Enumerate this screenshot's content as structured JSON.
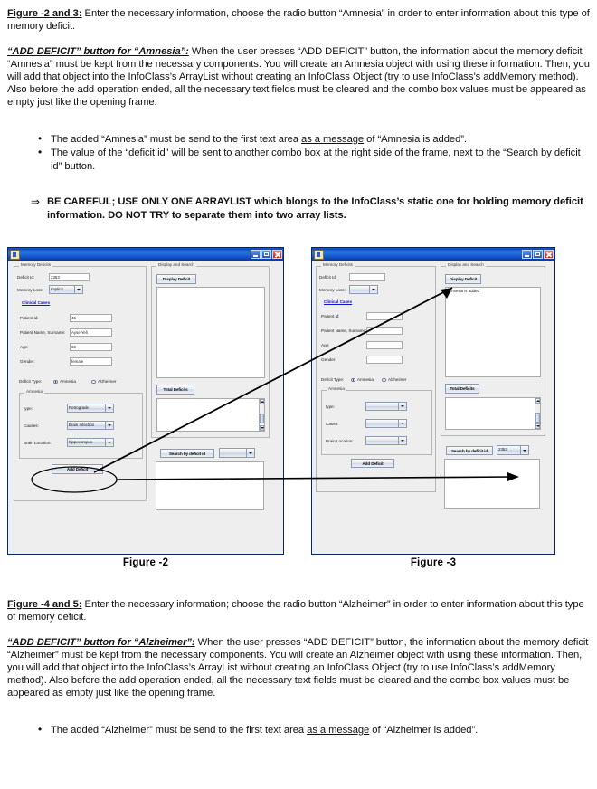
{
  "document": {
    "para1": {
      "lead": "Figure -2 and 3:",
      "body": " Enter the necessary information, choose the radio button “Amnesia” in order to enter information about this type of memory deficit."
    },
    "para2": {
      "lead": "“ADD DEFICIT” button for “Amnesia”:",
      "body": " When the user presses “ADD DEFICIT” button, the information about the memory deficit “Amnesia” must be kept from the necessary components. You will create an Amnesia object with using these information. Then, you will add that object into the InfoClass’s ArrayList without creating an InfoClass Object (try to use InfoClass’s addMemory method). Also before the add operation ended, all the necessary text fields must be cleared and the combo box values must be appeared as empty just like the opening frame."
    },
    "bullets1": [
      {
        "pre": "The added “Amnesia” must be send to the first text area ",
        "underline": "as a message",
        "post": " of “Amnesia is added”."
      },
      {
        "pre": "The value of the “deficit id” will be sent to another combo box at the right side of the frame, next to the “Search by deficit id” button.",
        "underline": "",
        "post": ""
      }
    ],
    "callout": "BE CAREFUL; USE ONLY ONE ARRAYLIST which blongs to the InfoClass’s static one for holding memory deficit information. DO NOT TRY to separate them into two array lists.",
    "para3": {
      "lead": "Figure -4 and 5:",
      "body": " Enter the necessary information; choose the radio button “Alzheimer” in order to enter information about this type of memory deficit."
    },
    "para4": {
      "lead": "“ADD DEFICIT” button for “Alzheimer”:",
      "body": " When the user presses “ADD DEFICIT” button, the information about the memory deficit “Alzheimer” must be kept from the necessary components. You will create an Alzheimer object with using these information. Then, you will add that object into the InfoClass’s ArrayList without creating an InfoClass Object (try to use InfoClass’s addMemory method). Also before the add operation ended, all the necessary text fields must be cleared and the combo box values must be appeared as empty just like the opening frame."
    },
    "bullets2": [
      {
        "pre": "The added “Alzheimer” must be send to the first text area ",
        "underline": "as a message",
        "post": " of “Alzheimer is added”."
      }
    ]
  },
  "figure2": {
    "caption": "Figure -2",
    "window_title": "",
    "left_group_title": "Memory Deficits",
    "labels": {
      "deficit_id": "Deficit Id:",
      "memory_loss": "Memory Loss:",
      "clinical_cases": "Clinical Cases",
      "patient_id": "Patient id:",
      "patient_name": "Patient Name, Surname:",
      "age": "Age:",
      "gender": "Gender:",
      "deficit_type": "Deficit Type:",
      "amnesia_group": "Amnesia",
      "type": "type:",
      "causes": "Causes:",
      "brain_location": "Brain Location:"
    },
    "values": {
      "deficit_id": "2353",
      "memory_loss": "Implicit",
      "patient_id": "45",
      "patient_name": "Ayse Yeli",
      "age": "65",
      "gender": "female",
      "type": "Retrograde",
      "causes": "Brain Infection",
      "brain_location": "hippocampus"
    },
    "radios": {
      "amnesia": "Amnesia",
      "alzheimer": "Alzheimer",
      "selected": "amnesia"
    },
    "buttons": {
      "add_deficit": "Add Deficit",
      "display_deficit": "Display Deficit",
      "total_deficits": "Total Deficits",
      "search_by_deficit_id": "Search by deficit id"
    },
    "right_group_title": "Display and Search",
    "textareas": {
      "display": "",
      "total": "",
      "search": ""
    },
    "search_combo_value": ""
  },
  "figure3": {
    "caption": "Figure -3",
    "window_title": "",
    "left_group_title": "Memory Deficits",
    "labels": {
      "deficit_id": "Deficit Id:",
      "memory_loss": "Memory Loss:",
      "clinical_cases": "Clinical Cases",
      "patient_id": "Patient id:",
      "patient_name": "Patient Name, Surname:",
      "age": "Age:",
      "gender": "Gender:",
      "deficit_type": "Deficit Type:",
      "amnesia_group": "Amnesia",
      "type": "type:",
      "causes": "Cause:",
      "brain_location": "Brain Location:"
    },
    "values": {
      "deficit_id": "",
      "memory_loss": "",
      "patient_id": "",
      "patient_name": "",
      "age": "",
      "gender": "",
      "type": "",
      "causes": "",
      "brain_location": ""
    },
    "radios": {
      "amnesia": "Amnesia",
      "alzheimer": "Alzheimer",
      "selected": "amnesia"
    },
    "buttons": {
      "add_deficit": "Add Deficit",
      "display_deficit": "Display Deficit",
      "total_deficits": "Total Deficits",
      "search_by_deficit_id": "Search by deficit id"
    },
    "right_group_title": "Display and Search",
    "textareas": {
      "display": "Amnesia is added",
      "total": "",
      "search": ""
    },
    "search_combo_value": "2353"
  },
  "colors": {
    "titlebar_blue": "#0b49c0",
    "clinical_cases_blue": "#1414c8",
    "panel_bg": "#eeeeee",
    "annotation": "#000000"
  }
}
